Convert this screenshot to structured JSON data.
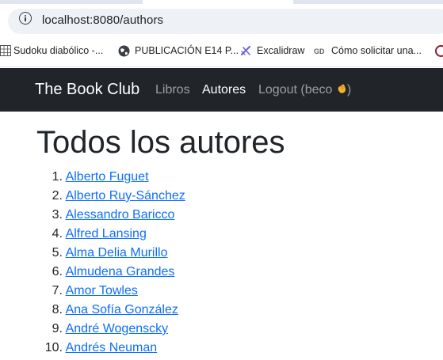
{
  "browser": {
    "url": "localhost:8080/authors"
  },
  "bookmarks": [
    {
      "label": "Sudoku diabólico -...",
      "icon": "sudoku-grid-icon"
    },
    {
      "label": "PUBLICACIÓN E14 P...",
      "icon": "globe-icon"
    },
    {
      "label": "Excalidraw",
      "icon": "excalidraw-icon"
    },
    {
      "label": "Cómo solicitar una...",
      "icon": "gd-icon"
    }
  ],
  "navbar": {
    "brand": "The Book Club",
    "links": [
      "Libros",
      "Autores",
      "Logout (beco "
    ],
    "logout_suffix": ")",
    "active_link": "Autores",
    "bg_color": "#212529"
  },
  "main": {
    "title": "Todos los autores",
    "authors": [
      "Alberto Fuguet",
      "Alberto Ruy-Sánchez",
      "Alessandro Baricco",
      "Alfred Lansing",
      "Alma Delia Murillo",
      "Almudena Grandes",
      "Amor Towles",
      "Ana Sofía González",
      "André Wogenscky",
      "Andrés Neuman"
    ],
    "numbers": [
      "1.",
      "2.",
      "3.",
      "4.",
      "5.",
      "6.",
      "7.",
      "8.",
      "9.",
      "10."
    ],
    "link_color": "#0d6efd"
  }
}
